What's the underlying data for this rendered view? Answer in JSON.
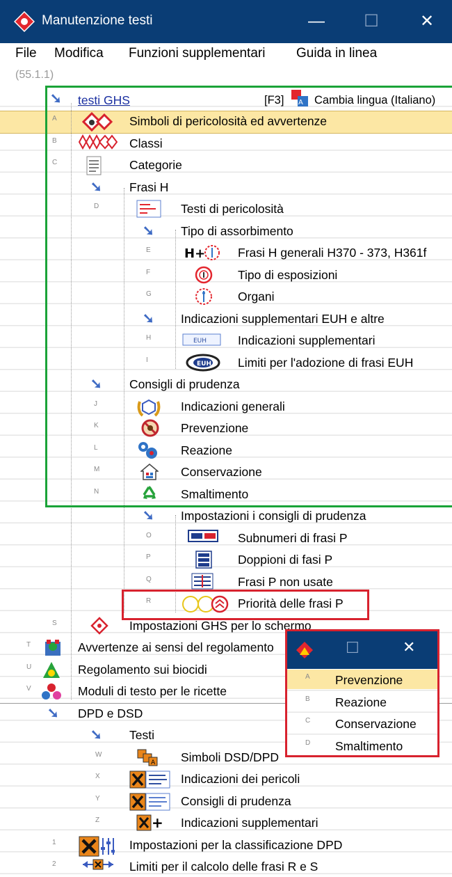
{
  "window": {
    "title": "Manutenzione testi",
    "minimize": "—",
    "maximize": "☐",
    "close": "✕"
  },
  "menu": [
    "File",
    "Modifica",
    "Funzioni supplementari",
    "Guida in linea"
  ],
  "version": "(55.1.1)",
  "tree": {
    "root_label": "testi GHS",
    "f3": "[F3]",
    "change_language": "Cambia lingua (Italiano)",
    "items": [
      {
        "letter": "A",
        "label": "Simboli di pericolosità ed avvertenze"
      },
      {
        "letter": "B",
        "label": "Classi"
      },
      {
        "letter": "C",
        "label": "Categorie"
      },
      {
        "letter": "",
        "label": "Frasi H"
      },
      {
        "letter": "D",
        "label": "Testi di pericolosità"
      },
      {
        "letter": "",
        "label": "Tipo di assorbimento"
      },
      {
        "letter": "E",
        "label": "Frasi H generali H370 - 373, H361f"
      },
      {
        "letter": "F",
        "label": "Tipo di esposizioni"
      },
      {
        "letter": "G",
        "label": "Organi"
      },
      {
        "letter": "",
        "label": "Indicazioni supplementari EUH e altre"
      },
      {
        "letter": "H",
        "label": "Indicazioni supplementari"
      },
      {
        "letter": "I",
        "label": "Limiti per l'adozione di frasi EUH"
      },
      {
        "letter": "",
        "label": "Consigli di prudenza"
      },
      {
        "letter": "J",
        "label": "Indicazioni generali"
      },
      {
        "letter": "K",
        "label": "Prevenzione"
      },
      {
        "letter": "L",
        "label": "Reazione"
      },
      {
        "letter": "M",
        "label": "Conservazione"
      },
      {
        "letter": "N",
        "label": "Smaltimento"
      },
      {
        "letter": "",
        "label": "Impostazioni i consigli di prudenza"
      },
      {
        "letter": "O",
        "label": "Subnumeri di frasi P"
      },
      {
        "letter": "P",
        "label": "Doppioni di fasi P"
      },
      {
        "letter": "Q",
        "label": "Frasi P non usate"
      },
      {
        "letter": "R",
        "label": "Priorità delle frasi P"
      },
      {
        "letter": "S",
        "label": "Impostazioni GHS per lo schermo"
      },
      {
        "letter": "T",
        "label": "Avvertenze ai sensi del regolamento"
      },
      {
        "letter": "U",
        "label": "Regolamento sui biocidi"
      },
      {
        "letter": "V",
        "label": "Moduli di testo per le ricette"
      },
      {
        "letter": "",
        "label": "DPD e DSD"
      },
      {
        "letter": "",
        "label": "Testi"
      },
      {
        "letter": "W",
        "label": "Simboli DSD/DPD"
      },
      {
        "letter": "X",
        "label": "Indicazioni dei pericoli"
      },
      {
        "letter": "Y",
        "label": "Consigli di prudenza"
      },
      {
        "letter": "Z",
        "label": "Indicazioni supplementari"
      },
      {
        "letter": "1",
        "label": "Impostazioni per la classificazione DPD"
      },
      {
        "letter": "2",
        "label": "Limiti per il calcolo delle frasi R e S"
      }
    ]
  },
  "popup": {
    "maximize": "☐",
    "close": "✕",
    "items": [
      {
        "letter": "A",
        "label": "Prevenzione"
      },
      {
        "letter": "B",
        "label": "Reazione"
      },
      {
        "letter": "C",
        "label": "Conservazione"
      },
      {
        "letter": "D",
        "label": "Smaltimento"
      }
    ]
  },
  "colors": {
    "titlebar": "#0a3d75",
    "selected_row": "#fce7a4",
    "green_frame": "#1aa338",
    "red_frame": "#d8222e",
    "arrow": "#3f6bc4"
  }
}
